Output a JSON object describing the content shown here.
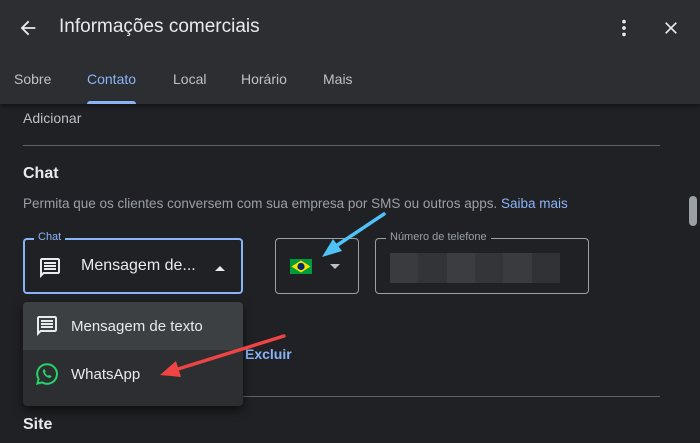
{
  "header": {
    "title": "Informações comerciais",
    "back_icon": "arrow-back-icon",
    "more_icon": "more-vert-icon",
    "close_icon": "close-icon"
  },
  "tabs": [
    {
      "label": "Sobre",
      "active": false
    },
    {
      "label": "Contato",
      "active": true
    },
    {
      "label": "Local",
      "active": false
    },
    {
      "label": "Horário",
      "active": false
    },
    {
      "label": "Mais",
      "active": false
    }
  ],
  "content": {
    "add_label": "Adicionar",
    "chat": {
      "title": "Chat",
      "description": "Permita que os clientes conversem com sua empresa por SMS ou outros apps.",
      "learn_more": "Saiba mais",
      "select_label": "Chat",
      "select_value": "Mensagem de...",
      "country_flag": "brazil-flag-icon",
      "phone_label": "Número de telefone",
      "delete_label": "Excluir"
    },
    "site_title": "Site"
  },
  "dropdown": {
    "options": [
      {
        "label": "Mensagem de texto",
        "icon": "message-icon",
        "selected": true
      },
      {
        "label": "WhatsApp",
        "icon": "whatsapp-icon",
        "selected": false
      }
    ]
  },
  "annotations": {
    "arrow_color_blue": "#4fc3f7",
    "arrow_color_red": "#ef4444"
  },
  "colors": {
    "background": "#202124",
    "header": "#2d2e31",
    "accent": "#8ab4f8",
    "text": "#e8eaed",
    "whatsapp": "#25d366"
  }
}
